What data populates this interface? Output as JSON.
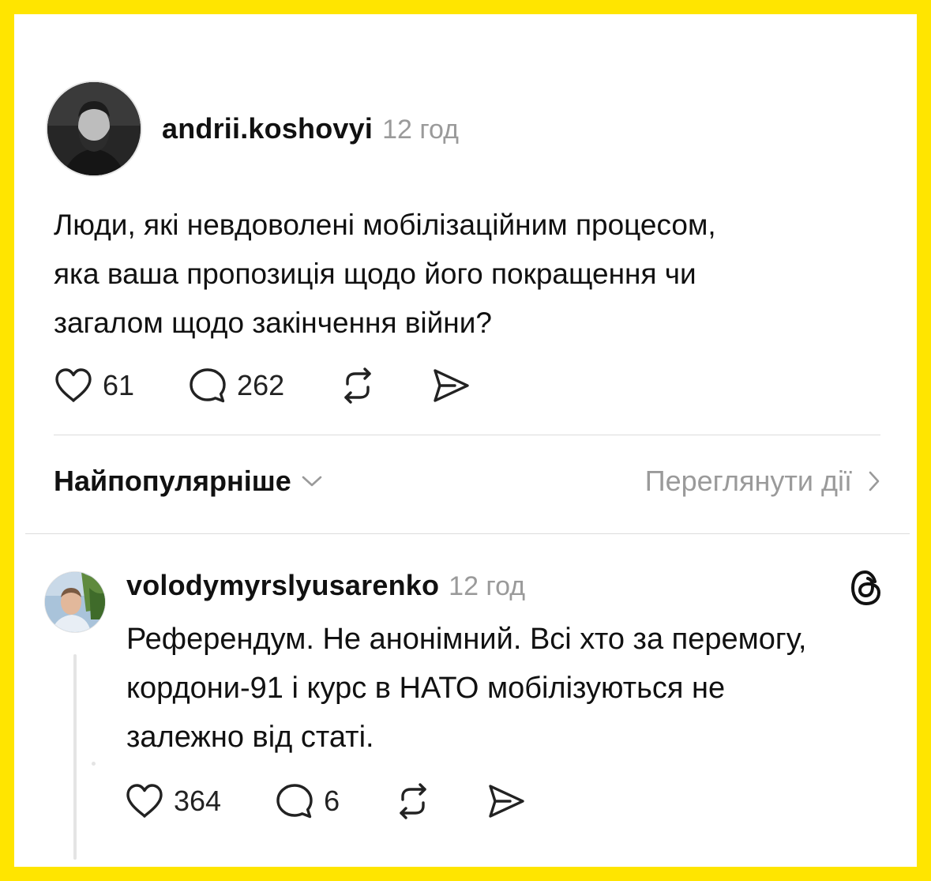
{
  "post": {
    "username": "andrii.koshovyi",
    "time": "12 год",
    "text": "Люди, які невдоволені мобілізаційним процесом,\nяка ваша  пропозиція щодо його покращення чи\nзагалом щодо закінчення війни?",
    "likes": "61",
    "comments": "262",
    "icons": [
      "heart-icon",
      "comment-icon",
      "repost-icon",
      "share-icon"
    ]
  },
  "sort": {
    "label": "Найпопулярніше",
    "view_activity": "Переглянути дії"
  },
  "reply": {
    "username": "volodymyrslyusarenko",
    "time": "12 год",
    "text": "Референдум. Не анонімний. Всі хто за перемогу, кордони-91 і курс в НАТО мобілізуються не залежно від статі.",
    "likes": "364",
    "comments": "6"
  },
  "colors": {
    "frame": "#FFE500",
    "card": "#FFFFFF",
    "text": "#111111",
    "muted": "#9A9A9A",
    "divider": "#DCDCDC"
  }
}
